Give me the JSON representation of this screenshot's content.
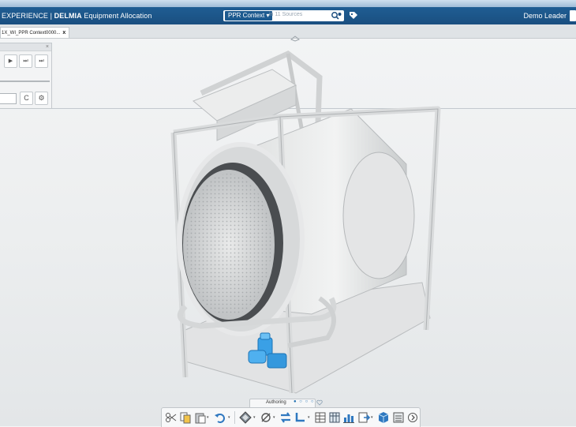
{
  "app": {
    "brand_prefix": "EXPERIENCE | ",
    "brand_bold": "DELMIA",
    "app_name": " Equipment Allocation",
    "user": "Demo Leader"
  },
  "search": {
    "context_label": "PPR Context ▾",
    "placeholder": "in 11 Sources"
  },
  "tabs": [
    {
      "label": "1X_WI_PPR Context0000...",
      "close": "x"
    }
  ],
  "panel": {
    "close": "×",
    "buttons": [
      "▶",
      "⏭",
      "⏭"
    ],
    "refresh_symbol": "C",
    "settings_symbol": "⚙"
  },
  "bottom": {
    "authoring_label": "Authoring",
    "page_dots": "● ○ ○ ○"
  },
  "toolbar_icons": [
    "cut-icon",
    "copy-icon",
    "paste-icon",
    "undo-icon",
    "snap-icon",
    "hide-show-icon",
    "transfer-icon",
    "route-icon",
    "table-icon",
    "grid-icon",
    "bar-chart-icon",
    "export-icon",
    "cube-icon",
    "list-icon",
    "more-icon"
  ],
  "colors": {
    "header_blue": "#1a4f80",
    "accent_blue": "#2f8fd6",
    "selected_part": "#3aa0e6"
  }
}
